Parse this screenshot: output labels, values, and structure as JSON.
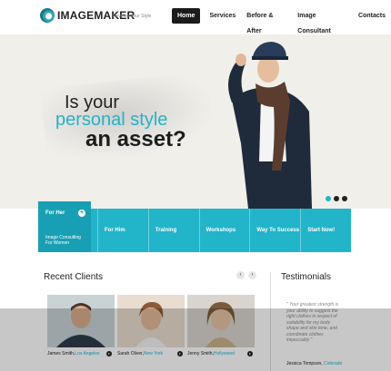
{
  "header": {
    "logo_text": "IMAGEMAKER",
    "logo_tagline": "Develop Your Style",
    "nav": [
      "Home",
      "Services",
      "Before & After",
      "Image Consultant",
      "Contacts"
    ],
    "active_nav": "Home"
  },
  "hero": {
    "line1": "Is your",
    "line2": "personal style",
    "line3": "an asset?",
    "slides": 3,
    "active_slide": 1
  },
  "tabs": {
    "first": {
      "label": "For Her",
      "sub_line1": "Image Consulting",
      "sub_line2": "For Women",
      "icon": "plus-icon"
    },
    "items": [
      "For Him",
      "Training",
      "Workshops",
      "Way To Success",
      "Start Now!"
    ]
  },
  "recent_clients": {
    "title": "Recent Clients",
    "prev_icon": "chevron-left-icon",
    "next_icon": "chevron-right-icon",
    "clients": [
      {
        "name": "James Smith,",
        "city": "Los Angeles"
      },
      {
        "name": "Sarah Oliver,",
        "city": "New York"
      },
      {
        "name": "Jenny Smith,",
        "city": "Hollywood"
      }
    ]
  },
  "testimonials": {
    "title": "Testimonials",
    "quote": "\" Your greatest strength is your ability to suggest the right clothes in respect of suitability for my body shape and skin tone, and coordinate clothes impeccably \"",
    "author_name": "Jessica Tompson,",
    "author_city": "Colorado"
  },
  "colors": {
    "accent": "#22b4c9",
    "dark": "#1b1b1b",
    "hero_bg": "#f1efea"
  }
}
